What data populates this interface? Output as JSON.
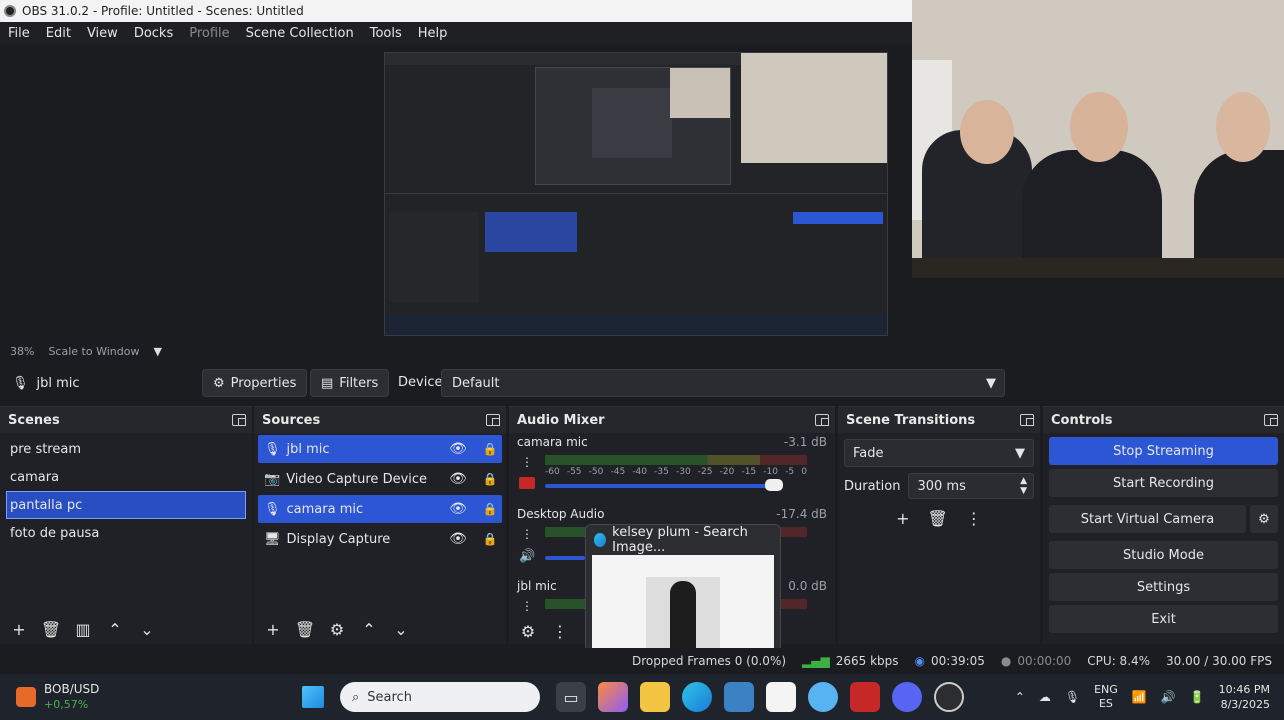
{
  "window": {
    "title": "OBS 31.0.2 - Profile: Untitled - Scenes: Untitled"
  },
  "menu": [
    "File",
    "Edit",
    "View",
    "Docks",
    "Profile",
    "Scene Collection",
    "Tools",
    "Help"
  ],
  "preview": {
    "zoom": "38%",
    "scale_mode": "Scale to Window"
  },
  "source_toolbar": {
    "selected_source": "jbl mic",
    "properties_label": "Properties",
    "filters_label": "Filters",
    "device_label": "Device",
    "device_value": "Default"
  },
  "scenes": {
    "title": "Scenes",
    "items": [
      "pre stream",
      "camara",
      "pantalla pc",
      "foto de pausa"
    ],
    "selected_index": 2
  },
  "sources": {
    "title": "Sources",
    "items": [
      {
        "label": "jbl mic",
        "icon": "mic-icon",
        "selected": true
      },
      {
        "label": "Video Capture Device",
        "icon": "camera-icon",
        "selected": false
      },
      {
        "label": "camara mic",
        "icon": "mic-icon",
        "selected": true
      },
      {
        "label": "Display Capture",
        "icon": "monitor-icon",
        "selected": false
      }
    ]
  },
  "audio_mixer": {
    "title": "Audio Mixer",
    "channels": [
      {
        "name": "camara mic",
        "db": "-3.1 dB"
      },
      {
        "name": "Desktop Audio",
        "db": "-17.4 dB"
      },
      {
        "name": "jbl mic",
        "db": "0.0 dB"
      }
    ],
    "ticks": [
      "-60",
      "-55",
      "-50",
      "-45",
      "-40",
      "-35",
      "-30",
      "-25",
      "-20",
      "-15",
      "-10",
      "-5",
      "0"
    ]
  },
  "scene_transitions": {
    "title": "Scene Transitions",
    "transition": "Fade",
    "duration_label": "Duration",
    "duration_value": "300 ms"
  },
  "controls": {
    "title": "Controls",
    "buttons": [
      "Stop Streaming",
      "Start Recording",
      "Start Virtual Camera",
      "Studio Mode",
      "Settings",
      "Exit"
    ]
  },
  "popup": {
    "title": "kelsey plum - Search Image..."
  },
  "statusbar": {
    "dropped": "Dropped Frames 0 (0.0%)",
    "bitrate": "2665 kbps",
    "stream_time": "00:39:05",
    "record_time": "00:00:00",
    "cpu": "CPU: 8.4%",
    "fps": "30.00 / 30.00 FPS"
  },
  "taskbar": {
    "ticker_name": "BOB/USD",
    "ticker_change": "+0,57%",
    "search_placeholder": "Search",
    "lang": "ENG",
    "region": "ES",
    "time": "10:46 PM",
    "date": "8/3/2025"
  },
  "colors": {
    "accent": "#2d56d5",
    "panel": "#202126",
    "stop_red": "#c62828"
  }
}
